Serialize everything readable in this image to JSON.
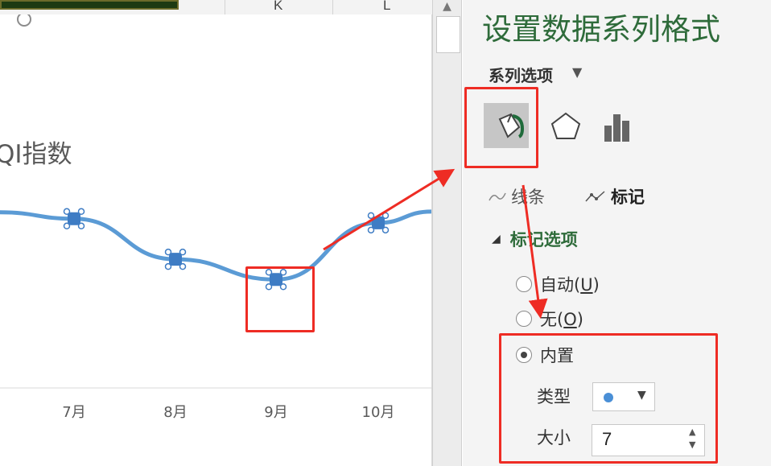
{
  "spreadsheet": {
    "columns": [
      "K",
      "L"
    ]
  },
  "chart": {
    "title_fragment": "QI指数"
  },
  "chart_data": {
    "type": "line",
    "title": "QI指数",
    "categories": [
      "7月",
      "8月",
      "9月",
      "10月"
    ],
    "series": [
      {
        "values": [
          66,
          56,
          51,
          65
        ]
      }
    ],
    "ylim": [
      0,
      120
    ],
    "selected_point": "9月",
    "line_color": "#5b9bd5",
    "marker_color": "#3e7cc4"
  },
  "pane": {
    "title": "设置数据系列格式",
    "series_options_label": "系列选项",
    "tabs": {
      "fill_icon": "paint-bucket-icon",
      "effects_icon": "pentagon-icon",
      "size_icon": "bar-chart-icon"
    },
    "subtabs": {
      "line": "线条",
      "marker": "标记"
    },
    "marker_options": {
      "heading": "标记选项",
      "auto": {
        "text": "自动(",
        "key": "U",
        "end": ")"
      },
      "none": {
        "text": "无(",
        "key": "O",
        "end": ")"
      },
      "builtin": "内置",
      "selected": "builtin",
      "type_label": "类型",
      "type_value_icon": "circle-marker-icon",
      "size_label": "大小",
      "size_value": "7"
    }
  },
  "colors": {
    "pane_title": "#2e6b3a",
    "annotation": "#ee2c24"
  }
}
